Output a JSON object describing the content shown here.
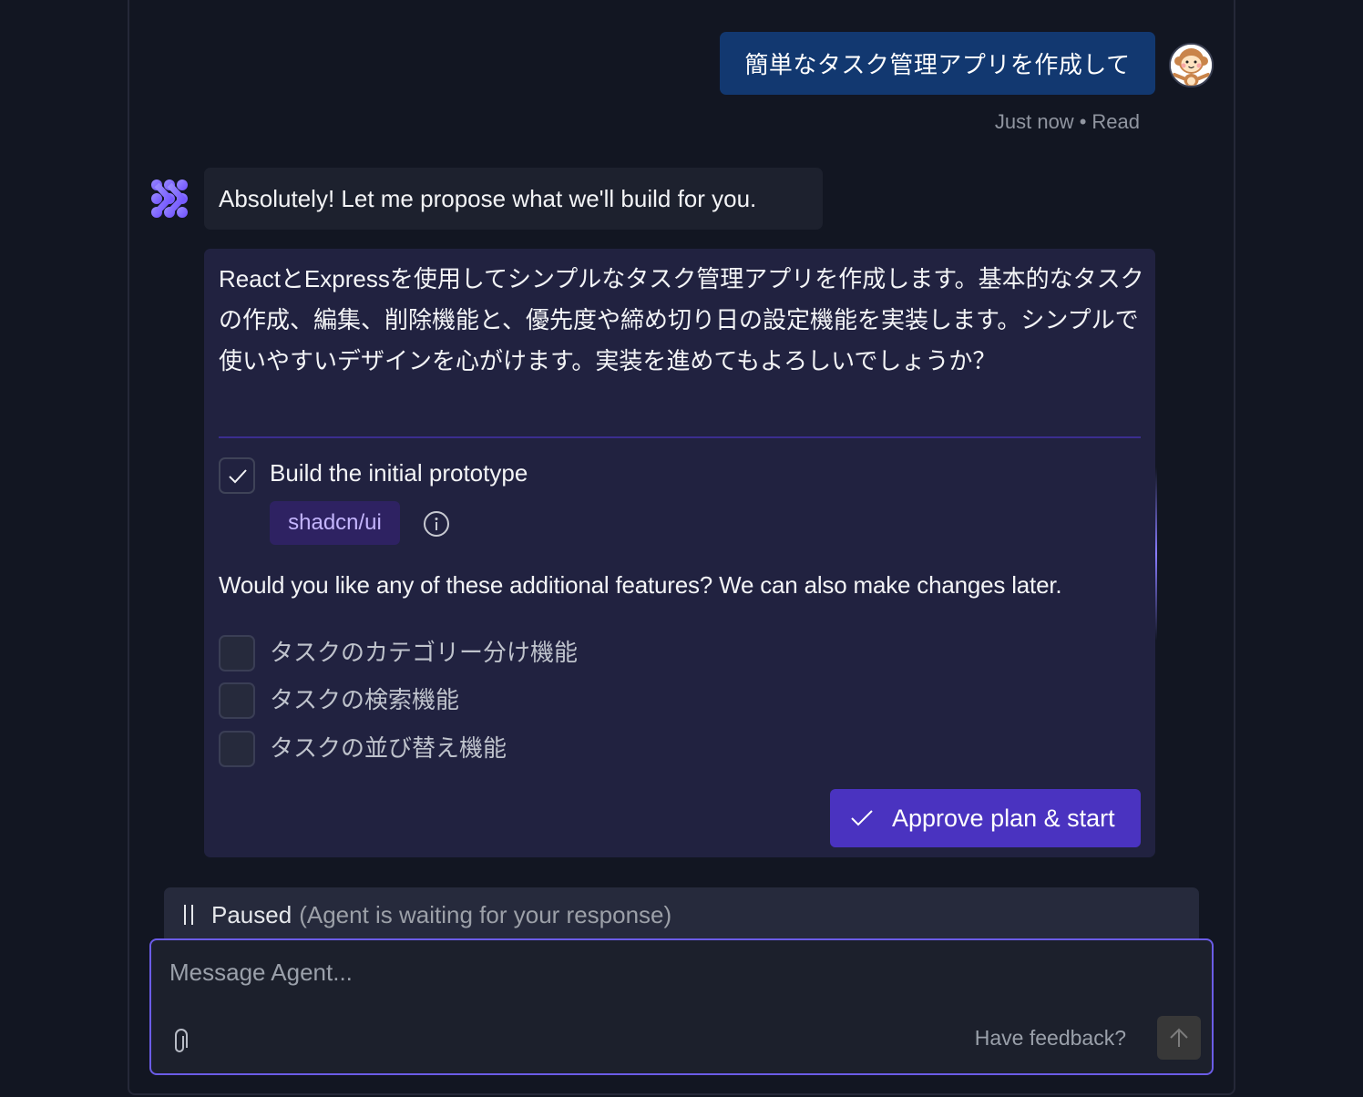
{
  "conversation": {
    "user_message": {
      "text": "簡単なタスク管理アプリを作成して",
      "time": "Just now",
      "separator": "•",
      "status": "Read",
      "avatar": "monkey-avatar"
    },
    "agent_message": {
      "text": "Absolutely! Let me propose what we'll build for you.",
      "logo": "agent-logo-icon"
    },
    "plan": {
      "description": "ReactとExpressを使用してシンプルなタスク管理アプリを作成します。基本的なタスクの作成、編集、削除機能と、優先度や締め切り日の設定機能を実装します。シンプルで使いやすいデザインを心がけます。実装を進めてもよろしいでしょうか？",
      "main_item": {
        "label": "Build the initial prototype",
        "checked": true,
        "tag": "shadcn/ui",
        "info_icon": "info-icon"
      },
      "question": "Would you like any of these additional features? We can also make changes later.",
      "options": [
        {
          "label": "タスクのカテゴリー分け機能",
          "checked": false
        },
        {
          "label": "タスクの検索機能",
          "checked": false
        },
        {
          "label": "タスクの並び替え機能",
          "checked": false
        }
      ],
      "approve_button": "Approve plan & start"
    }
  },
  "status_bar": {
    "label": "Paused",
    "detail": "(Agent is waiting for your response)"
  },
  "composer": {
    "placeholder": "Message Agent...",
    "value": "",
    "feedback_link": "Have feedback?",
    "accent_color": "#6b5ce7"
  },
  "colors": {
    "user_bubble": "#123870",
    "plan_card": "#212240",
    "approve_button": "#4a33c0",
    "tag_bg": "#2e2262",
    "tag_text": "#c4b5fd"
  }
}
